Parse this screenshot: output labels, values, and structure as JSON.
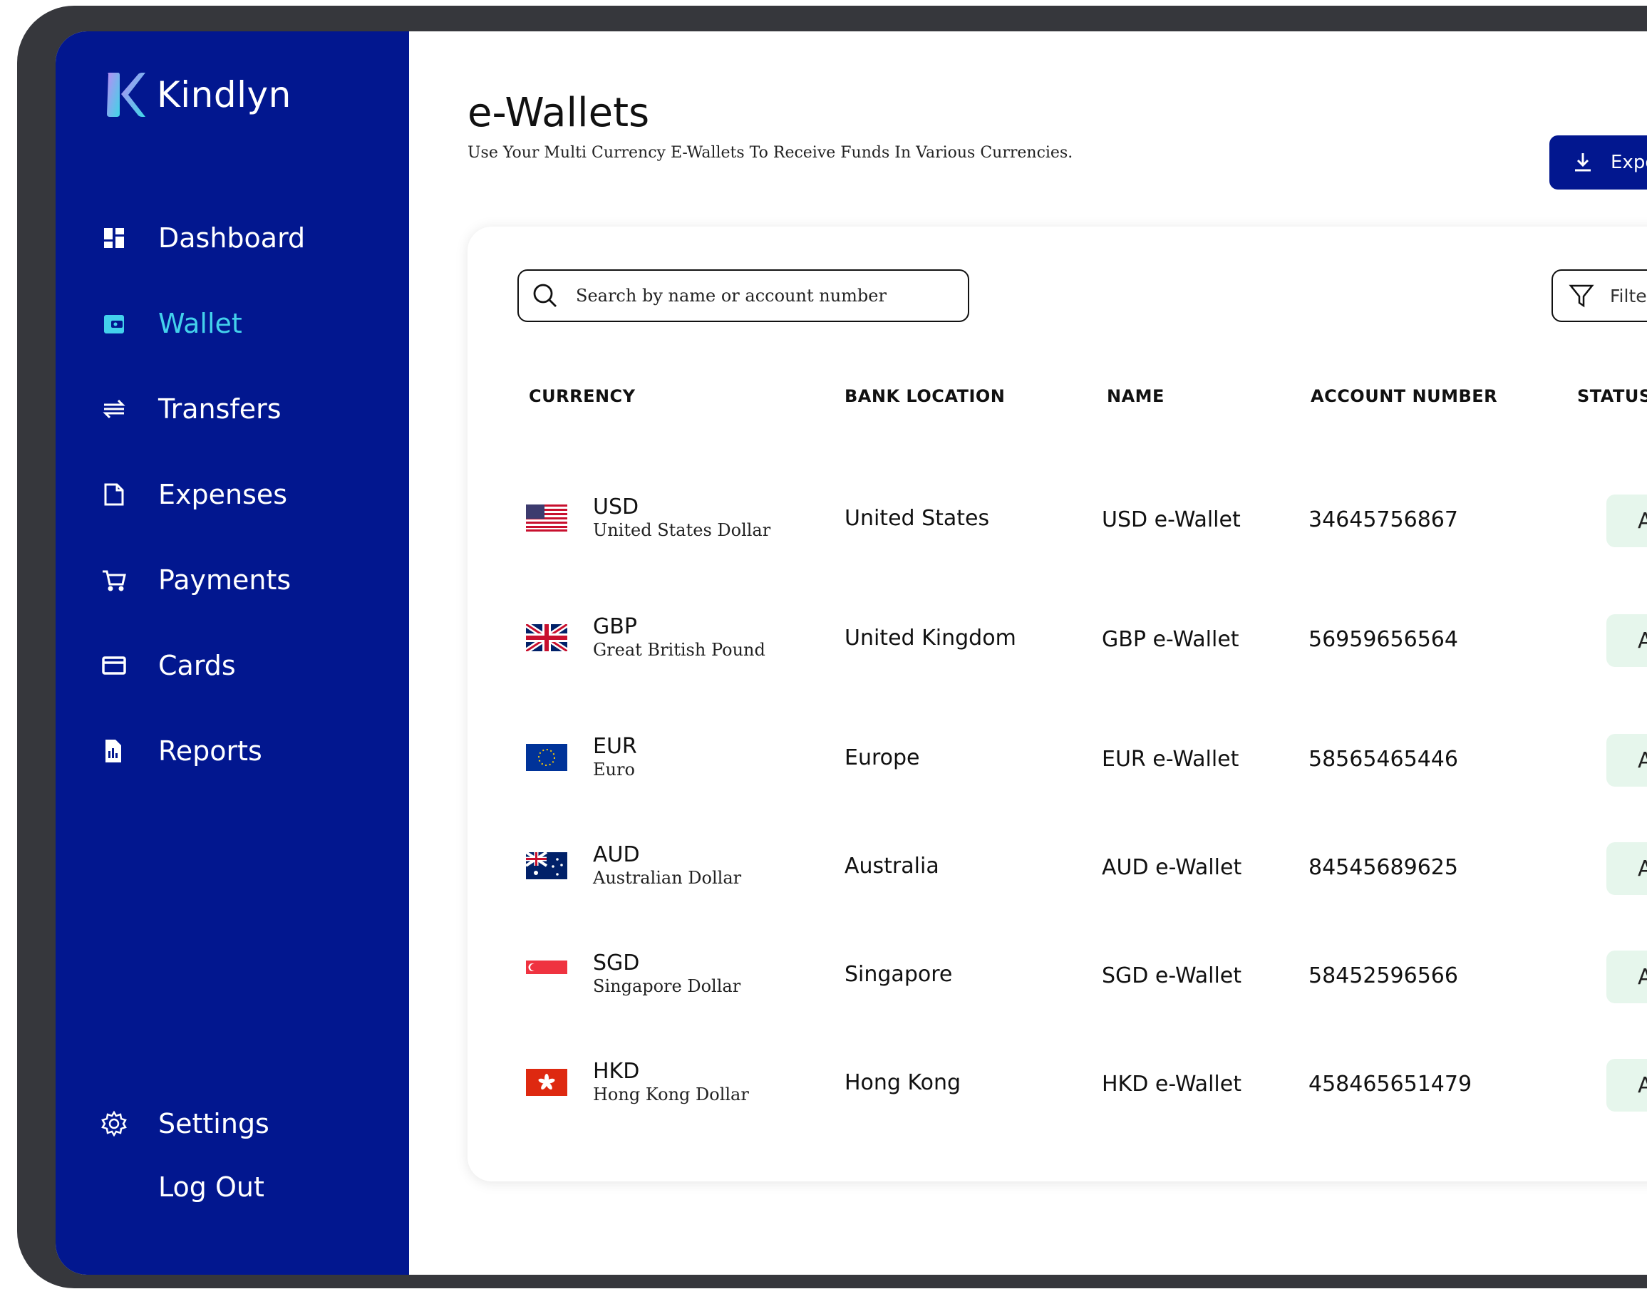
{
  "app": {
    "name": "Kindlyn"
  },
  "sidebar": {
    "items": [
      {
        "label": "Dashboard",
        "icon": "dashboard-icon"
      },
      {
        "label": "Wallet",
        "icon": "wallet-icon",
        "active": true
      },
      {
        "label": "Transfers",
        "icon": "transfers-icon"
      },
      {
        "label": "Expenses",
        "icon": "expenses-icon"
      },
      {
        "label": "Payments",
        "icon": "cart-icon"
      },
      {
        "label": "Cards",
        "icon": "card-icon"
      },
      {
        "label": "Reports",
        "icon": "reports-icon"
      }
    ],
    "settings": {
      "label": "Settings",
      "icon": "gear-icon"
    },
    "logout": {
      "label": "Log Out"
    }
  },
  "page": {
    "title": "e-Wallets",
    "subtitle": "Use Your Multi Currency E-Wallets To Receive Funds In Various Currencies.",
    "export_label": "Export"
  },
  "search": {
    "placeholder": "Search by name or account number",
    "value": ""
  },
  "filters": {
    "label": "Filters"
  },
  "table": {
    "columns": [
      "CURRENCY",
      "BANK LOCATION",
      "NAME",
      "ACCOUNT NUMBER",
      "STATUS"
    ],
    "rows": [
      {
        "flag": "us-flag",
        "code": "USD",
        "currency_name": "United States Dollar",
        "location": "United States",
        "name": "USD e-Wallet",
        "account": "34645756867",
        "status": "Active"
      },
      {
        "flag": "uk-flag",
        "code": "GBP",
        "currency_name": "Great British Pound",
        "location": "United Kingdom",
        "name": "GBP e-Wallet",
        "account": "56959656564",
        "status": "Active"
      },
      {
        "flag": "eu-flag",
        "code": "EUR",
        "currency_name": "Euro",
        "location": "Europe",
        "name": "EUR e-Wallet",
        "account": "58565465446",
        "status": "Active"
      },
      {
        "flag": "au-flag",
        "code": "AUD",
        "currency_name": "Australian Dollar",
        "location": "Australia",
        "name": "AUD e-Wallet",
        "account": "84545689625",
        "status": "Active"
      },
      {
        "flag": "sg-flag",
        "code": "SGD",
        "currency_name": "Singapore Dollar",
        "location": "Singapore",
        "name": "SGD e-Wallet",
        "account": "58452596566",
        "status": "Active"
      },
      {
        "flag": "hk-flag",
        "code": "HKD",
        "currency_name": "Hong Kong Dollar",
        "location": "Hong Kong",
        "name": "HKD e-Wallet",
        "account": "458465651479",
        "status": "Active"
      }
    ]
  },
  "colors": {
    "sidebar_bg": "#02178f",
    "active_nav": "#43d1ec",
    "status_bg": "#e6f6ec",
    "device_frame": "#36373c"
  }
}
